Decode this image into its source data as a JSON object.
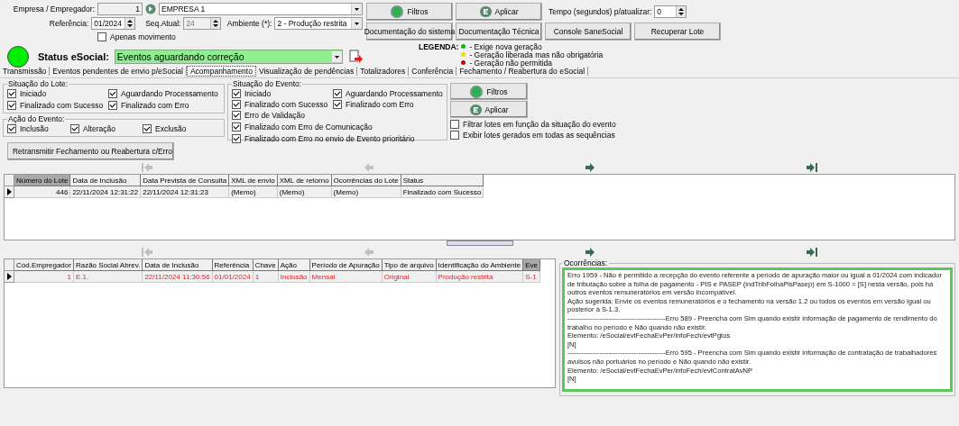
{
  "header": {
    "empresa": {
      "label": "Empresa / Empregador:",
      "code": "1",
      "name": "EMPRESA 1"
    },
    "referencia": {
      "label": "Referência:",
      "value": "01/2024"
    },
    "seq": {
      "label": "Seq.Atual:",
      "value": "24",
      "disabled": true
    },
    "ambiente": {
      "label": "Ambiente (*):",
      "value": "2 - Produção restrita"
    },
    "apenas_movimento": {
      "label": "Apenas movimento",
      "checked": false
    },
    "status": {
      "label": "Status eSocial:",
      "value": "Eventos aguardando correção"
    }
  },
  "top_buttons": [
    "Filtros",
    "Aplicar"
  ],
  "tempo": {
    "label": "Tempo (segundos) p/atualizar:",
    "value": "0"
  },
  "doc_buttons": [
    "Documentação do sistema",
    "Documentação Técnica",
    "Console SaneSocial",
    "Recuperar Lote"
  ],
  "legend": {
    "title": "LEGENDA:",
    "items": [
      {
        "label": "- Exige nova geração",
        "color": "#00c000"
      },
      {
        "label": "- Geração liberada mas não obrigatória",
        "color": "#e8e000"
      },
      {
        "label": "- Geração não permitida",
        "color": "#d00000"
      }
    ]
  },
  "tabs": [
    {
      "label": "Transmissão",
      "selected": false
    },
    {
      "label": "Eventos pendentes de envio p/eSocial",
      "selected": false
    },
    {
      "label": "Acompanhamento",
      "selected": true
    },
    {
      "label": "Visualização de pendências",
      "selected": false
    },
    {
      "label": "Totalizadores",
      "selected": false
    },
    {
      "label": "Conferência",
      "selected": false
    },
    {
      "label": "Fechamento / Reabertura do eSocial",
      "selected": false
    }
  ],
  "lote_group": {
    "title": "Situação do Lote:",
    "options": [
      {
        "label": "Iniciado",
        "checked": true
      },
      {
        "label": "Aguardando Processamento",
        "checked": true
      },
      {
        "label": "Finalizado com Sucesso",
        "checked": true
      },
      {
        "label": "Finalizado com Erro",
        "checked": true
      }
    ]
  },
  "acao_group": {
    "title": "Ação do Evento:",
    "options": [
      {
        "label": "Inclusão",
        "checked": true
      },
      {
        "label": "Alteração",
        "checked": true
      },
      {
        "label": "Exclusão",
        "checked": true
      }
    ]
  },
  "evento_group": {
    "title": "Situação do  Evento:",
    "options": [
      {
        "label": "Iniciado",
        "checked": true
      },
      {
        "label": "Aguardando Processamento",
        "checked": true
      },
      {
        "label": "Finalizado com Sucesso",
        "checked": true
      },
      {
        "label": "Finalizado com Erro",
        "checked": true
      }
    ],
    "extra_options": [
      {
        "label": "Erro de Validação",
        "checked": true
      },
      {
        "label": "Finalizado com Erro de Comunicação",
        "checked": true
      },
      {
        "label": "Finalizado com Erro no envio de Evento prioritário",
        "checked": true
      }
    ]
  },
  "filter_buttons": [
    "Filtros",
    "Aplicar"
  ],
  "filter_options": [
    {
      "label": "Filtrar lotes em função da situação do evento",
      "checked": false
    },
    {
      "label": "Exibir lotes gerados em todas as sequências",
      "checked": false
    }
  ],
  "retransmit_button": "Retransmitir Fechamento ou Reabertura c/Erro",
  "navigator": [
    {
      "kind": "first",
      "disabled": true
    },
    {
      "kind": "prior",
      "disabled": true
    },
    {
      "kind": "next",
      "disabled": false
    },
    {
      "kind": "last",
      "disabled": false
    }
  ],
  "lotes_table": {
    "columns": [
      {
        "label": "Número do Lote",
        "highlighted": true
      },
      {
        "label": "Data de Inclusão",
        "highlighted": false
      },
      {
        "label": "Data Prevista de Consulta",
        "highlighted": false
      },
      {
        "label": "XML de envio",
        "highlighted": false
      },
      {
        "label": "XML de retorno",
        "highlighted": false
      },
      {
        "label": "Ocorrências do Lote",
        "highlighted": false
      },
      {
        "label": "Status",
        "highlighted": false
      }
    ],
    "rows": [
      {
        "selected": true,
        "error": false,
        "cells": [
          "446",
          "22/11/2024 12:31:22",
          "22/11/2024 12:31:23",
          "(Memo)",
          "(Memo)",
          "(Memo)",
          "Finalizado com Sucesso"
        ]
      }
    ]
  },
  "navigator_2": [
    {
      "kind": "first",
      "disabled": true
    },
    {
      "kind": "prior",
      "disabled": true
    },
    {
      "kind": "next",
      "disabled": false
    },
    {
      "kind": "last",
      "disabled": false
    }
  ],
  "eventos_table": {
    "columns": [
      {
        "label": "Cód.Empregador",
        "highlighted": false
      },
      {
        "label": "Razão Social Abrev.",
        "highlighted": false
      },
      {
        "label": "Data de Inclusão",
        "highlighted": false
      },
      {
        "label": "Referência",
        "highlighted": false
      },
      {
        "label": "Chave",
        "highlighted": false
      },
      {
        "label": "Ação",
        "highlighted": false
      },
      {
        "label": "Período de Apuração",
        "highlighted": false
      },
      {
        "label": "Tipo de arquivo",
        "highlighted": false
      },
      {
        "label": "Identificação do Ambiente",
        "highlighted": false
      },
      {
        "label": "Eve",
        "highlighted": true
      }
    ],
    "rows": [
      {
        "selected": true,
        "error": true,
        "cells": [
          "1",
          "E.1.",
          "22/11/2024 11:30:56",
          "01/01/2024",
          "1",
          "Inclusão",
          "Mensal",
          "Original",
          "Produção restrita",
          "S-1"
        ]
      }
    ]
  },
  "ocorrencias": {
    "title": "Ocorrências:",
    "lines": [
      "Erro 1959 - Não é permitido a recepção do evento referente a período de apuração maior ou igual a 01/2024 com indicador de tributação sobre a folha de pagamento - PIS e PASEP (indTribFolhaPisPasep) em S-1000 = [S] nesta versão, pois há outros eventos remuneratórios em versão incompatível.",
      "Ação sugerida: Envie os eventos remuneratórios e o fechamento na versão 1.2 ou todos os eventos em versão igual ou posterior à S-1.3.",
      "-------------------------------------------Erro 589 - Preencha com Sim quando existir informação de pagamento de rendimento do trabalho no período e Não quando não existir.",
      "Elemento: /eSocial/evtFechaEvPer/infoFech/evtPgtos",
      "[N]",
      "-------------------------------------------Erro 595 - Preencha com Sim quando existir informação de contratação de trabalhadores avulsos não portuários no período e Não quando não existir.",
      "Elemento: /eSocial/evtFechaEvPer/infoFech/evtContratAvNP",
      "[N]"
    ]
  }
}
